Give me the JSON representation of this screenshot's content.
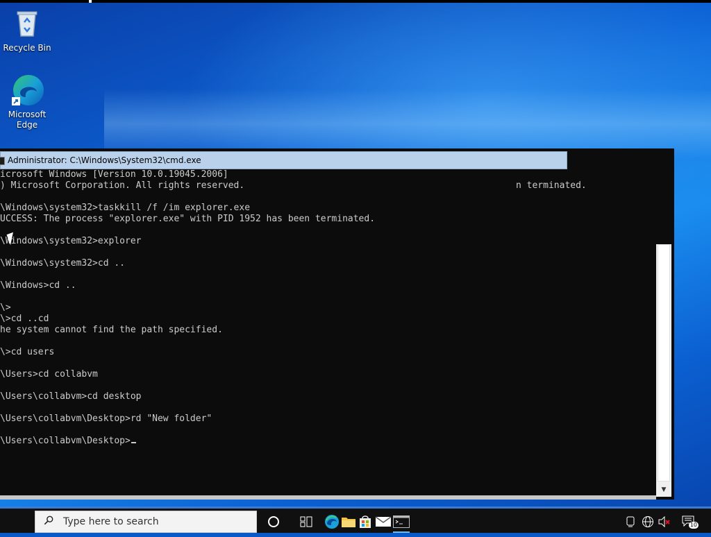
{
  "desktop": {
    "icons": [
      {
        "label": "Recycle Bin",
        "icon": "recycle-bin-icon"
      },
      {
        "label": "Microsoft Edge",
        "icon": "edge-icon"
      }
    ]
  },
  "cmd_window": {
    "title": "Administrator: C:\\Windows\\System32\\cmd.exe",
    "ghost_text": "n terminated.",
    "lines": [
      "icrosoft Windows [Version 10.0.19045.2006]",
      ") Microsoft Corporation. All rights reserved.",
      "",
      "\\Windows\\system32>taskkill /f /im explorer.exe",
      "UCCESS: The process \"explorer.exe\" with PID 1952 has been terminated.",
      "",
      "\\Windows\\system32>explorer",
      "",
      "\\Windows\\system32>cd ..",
      "",
      "\\Windows>cd ..",
      "",
      "\\>",
      "\\>cd ..cd",
      "he system cannot find the path specified.",
      "",
      "\\>cd users",
      "",
      "\\Users>cd collabvm",
      "",
      "\\Users\\collabvm>cd desktop",
      "",
      "\\Users\\collabvm\\Desktop>rd \"New folder\"",
      "",
      "\\Users\\collabvm\\Desktop>"
    ]
  },
  "taskbar": {
    "search_placeholder": "Type here to search",
    "pinned": [
      "cortana-icon",
      "task-view-icon",
      "edge-icon",
      "file-explorer-icon",
      "store-icon",
      "mail-icon",
      "cmd-icon"
    ],
    "tray": [
      "people-icon",
      "network-icon",
      "volume-muted-icon",
      "action-center-icon"
    ],
    "notification_count": "10"
  },
  "colors": {
    "taskbar": "#101010",
    "console_bg": "#0c0c0c",
    "console_text": "#cccccc",
    "title_bar": "#b9d1ea"
  }
}
